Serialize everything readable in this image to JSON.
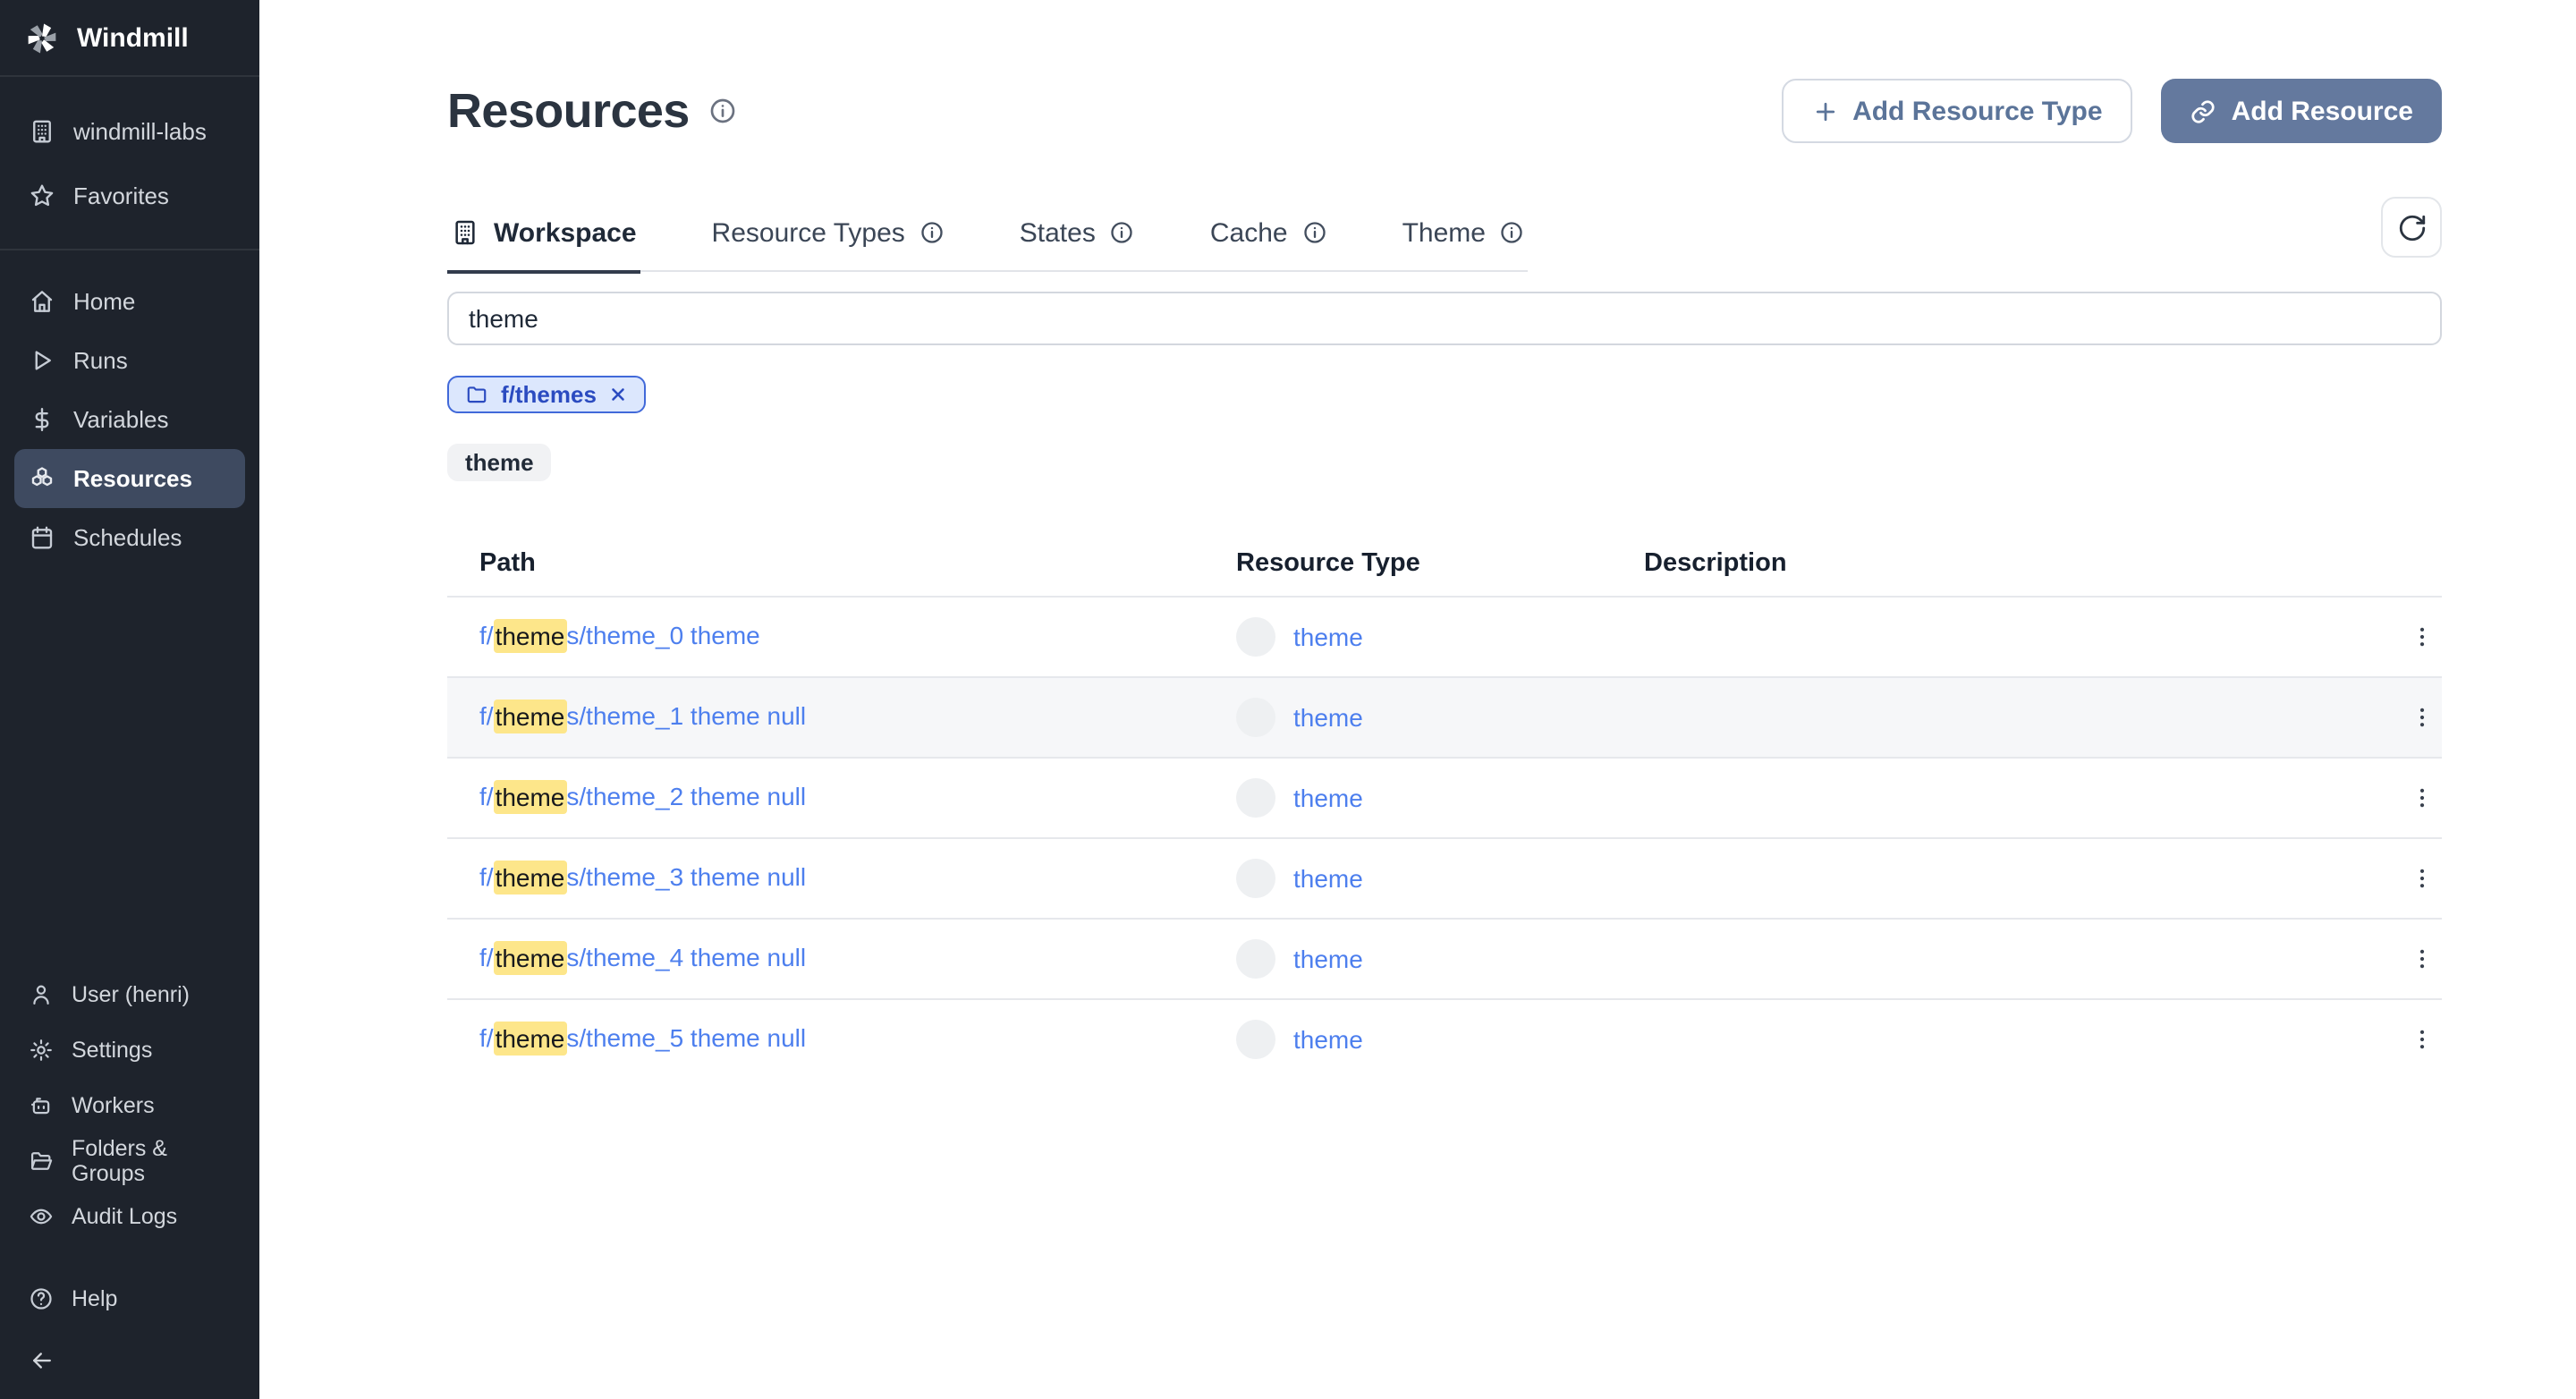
{
  "app": {
    "name": "Windmill"
  },
  "colors": {
    "accent": "#64799e",
    "link": "#4d7fee",
    "highlight": "#fde68a",
    "sidebar_bg": "#1e232c",
    "active_item_bg": "#3e4a60"
  },
  "sidebar": {
    "workspace": {
      "label": "windmill-labs"
    },
    "favorites": {
      "label": "Favorites"
    },
    "nav": [
      {
        "label": "Home",
        "active": false
      },
      {
        "label": "Runs",
        "active": false
      },
      {
        "label": "Variables",
        "active": false
      },
      {
        "label": "Resources",
        "active": true
      },
      {
        "label": "Schedules",
        "active": false
      }
    ],
    "secondary": [
      {
        "label": "User (henri)"
      },
      {
        "label": "Settings"
      },
      {
        "label": "Workers"
      },
      {
        "label": "Folders & Groups"
      },
      {
        "label": "Audit Logs"
      }
    ],
    "help": {
      "label": "Help"
    }
  },
  "header": {
    "title": "Resources",
    "buttons": {
      "add_resource_type": "Add Resource Type",
      "add_resource": "Add Resource"
    }
  },
  "tabs": [
    {
      "label": "Workspace",
      "active": true
    },
    {
      "label": "Resource Types",
      "active": false
    },
    {
      "label": "States",
      "active": false
    },
    {
      "label": "Cache",
      "active": false
    },
    {
      "label": "Theme",
      "active": false
    }
  ],
  "search": {
    "value": "theme"
  },
  "filters": {
    "folder_chip": "f/themes",
    "resource_type_chip": "theme"
  },
  "table": {
    "columns": [
      "Path",
      "Resource Type",
      "Description"
    ],
    "rows": [
      {
        "path_prefix": "f/",
        "path_match": "theme",
        "path_rest": "s/theme_0 theme",
        "resource_type": "theme",
        "description": "",
        "striped": false
      },
      {
        "path_prefix": "f/",
        "path_match": "theme",
        "path_rest": "s/theme_1 theme null",
        "resource_type": "theme",
        "description": "",
        "striped": true
      },
      {
        "path_prefix": "f/",
        "path_match": "theme",
        "path_rest": "s/theme_2 theme null",
        "resource_type": "theme",
        "description": "",
        "striped": false
      },
      {
        "path_prefix": "f/",
        "path_match": "theme",
        "path_rest": "s/theme_3 theme null",
        "resource_type": "theme",
        "description": "",
        "striped": false
      },
      {
        "path_prefix": "f/",
        "path_match": "theme",
        "path_rest": "s/theme_4 theme null",
        "resource_type": "theme",
        "description": "",
        "striped": false
      },
      {
        "path_prefix": "f/",
        "path_match": "theme",
        "path_rest": "s/theme_5 theme null",
        "resource_type": "theme",
        "description": "",
        "striped": false
      }
    ]
  }
}
